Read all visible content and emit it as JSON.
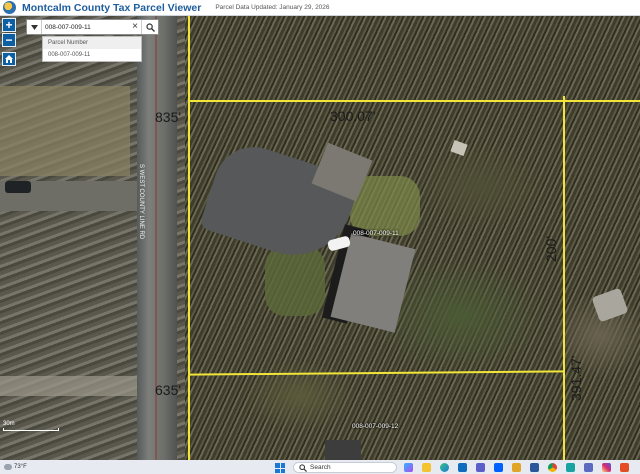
{
  "header": {
    "title": "Montcalm County Tax Parcel Viewer",
    "updated": "Parcel Data Updated: January 29, 2026"
  },
  "search": {
    "value": "008-007-009-11",
    "clear_glyph": "×"
  },
  "suggestions": {
    "header": "Parcel Number",
    "items": [
      "008-007-009-11"
    ]
  },
  "controls": {
    "zoom_in": "+",
    "zoom_out": "−"
  },
  "map": {
    "road_label": "S WEST COUNTY LINE RD",
    "dimensions": {
      "west_top": "835'",
      "top": "300.07'",
      "east": "200'",
      "west_bottom": "635'",
      "east_lower": "391.47'"
    },
    "parcels": {
      "main": "008-007-009-11",
      "south": "008-007-009-12"
    },
    "scale": "30m"
  },
  "taskbar": {
    "temperature": "73°F",
    "search": "Search"
  },
  "colors": {
    "header_title": "#1f5e9c",
    "button": "#0d5fa3",
    "parcel_line": "#f2e53a"
  }
}
